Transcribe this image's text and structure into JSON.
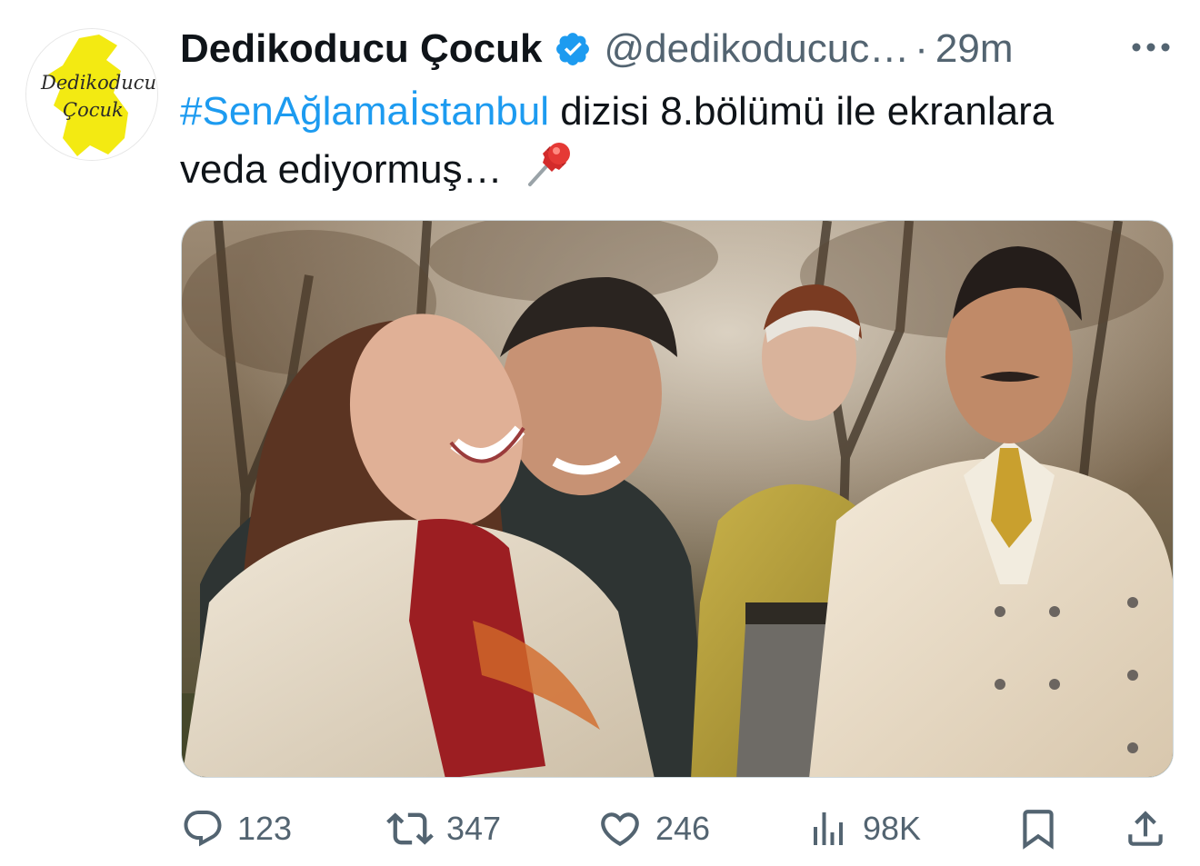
{
  "tweet": {
    "author": {
      "display_name": "Dedikoducu Çocuk",
      "handle": "@dedikoducuc…",
      "verified": true,
      "avatar_text_line1": "Dedikoducu",
      "avatar_text_line2": "Çocuk"
    },
    "separator": "·",
    "time": "29m",
    "text": {
      "hashtag": "#SenAğlamaİstanbul",
      "line1_rest": " dizisi 8.bölümü ile ekranlara",
      "line2": "veda ediyormuş… "
    },
    "pin_emoji_icon": "pushpin-icon",
    "metrics": {
      "replies": "123",
      "retweets": "347",
      "likes": "246",
      "views": "98K"
    },
    "colors": {
      "link": "#1d9bf0",
      "secondary": "#536471",
      "text": "#0f1419",
      "verified": "#1d9bf0",
      "avatar_yellow": "#f3ea12"
    }
  }
}
